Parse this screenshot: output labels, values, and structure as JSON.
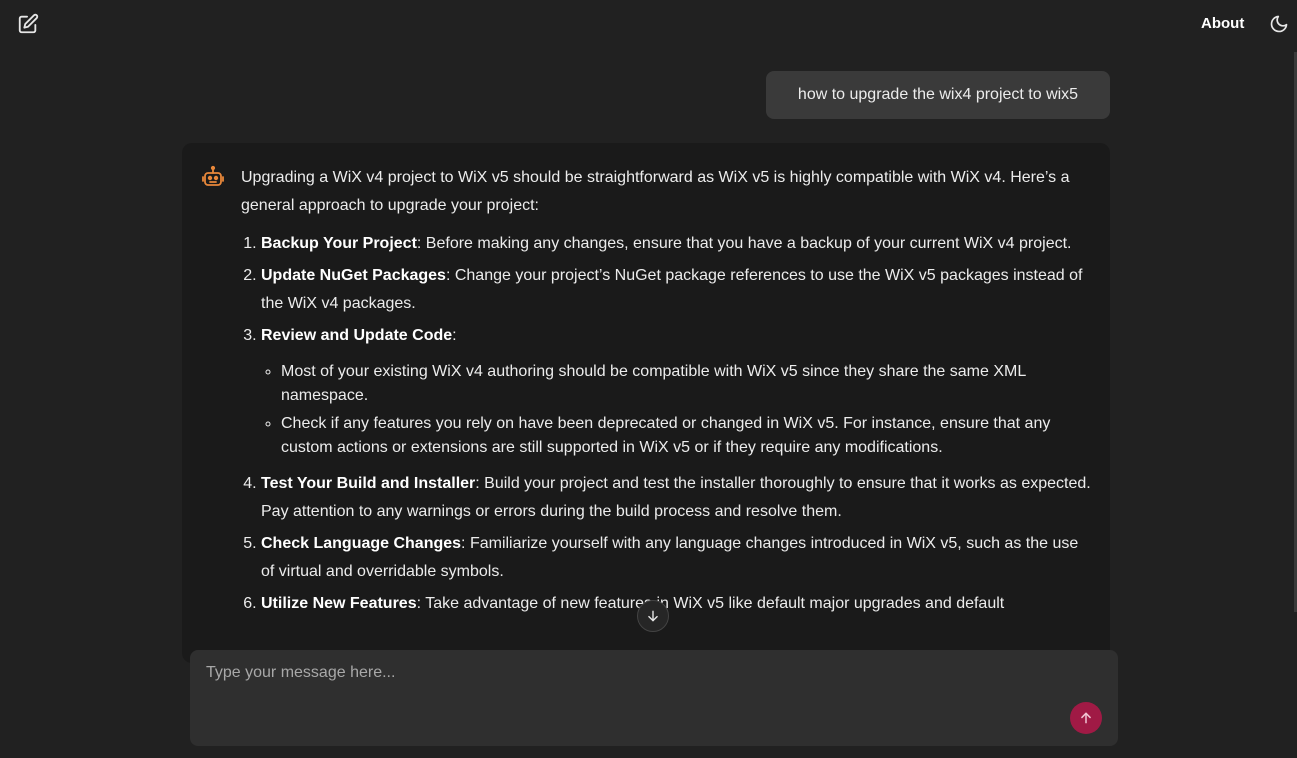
{
  "header": {
    "new_chat_icon": "edit-square-icon",
    "about_label": "About",
    "theme_icon": "moon-icon"
  },
  "user_message": {
    "text": "how to upgrade the wix4 project to wix5"
  },
  "assistant_message": {
    "avatar_icon": "robot-icon",
    "intro": "Upgrading a WiX v4 project to WiX v5 should be straightforward as WiX v5 is highly compatible with WiX v4. Here’s a general approach to upgrade your project:",
    "steps": [
      {
        "title": "Backup Your Project",
        "text": ": Before making any changes, ensure that you have a backup of your current WiX v4 project."
      },
      {
        "title": "Update NuGet Packages",
        "text": ": Change your project’s NuGet package references to use the WiX v5 packages instead of the WiX v4 packages."
      },
      {
        "title": "Review and Update Code",
        "text": ":",
        "bullets": [
          "Most of your existing WiX v4 authoring should be compatible with WiX v5 since they share the same XML namespace.",
          "Check if any features you rely on have been deprecated or changed in WiX v5. For instance, ensure that any custom actions or extensions are still supported in WiX v5 or if they require any modifications."
        ]
      },
      {
        "title": "Test Your Build and Installer",
        "text": ": Build your project and test the installer thoroughly to ensure that it works as expected. Pay attention to any warnings or errors during the build process and resolve them."
      },
      {
        "title": "Check Language Changes",
        "text": ": Familiarize yourself with any language changes introduced in WiX v5, such as the use of virtual and overridable symbols."
      },
      {
        "title": "Utilize New Features",
        "text": ": Take advantage of new features in WiX v5 like default major upgrades and default"
      }
    ]
  },
  "scroll_down_icon": "arrow-down-icon",
  "composer": {
    "placeholder": "Type your message here...",
    "send_icon": "arrow-up-icon",
    "send_color": "#a01a45"
  },
  "colors": {
    "background": "#212121",
    "assistant_card": "#1a1a1a",
    "user_bubble": "#3a3a3a",
    "composer": "#2f2f2f"
  }
}
